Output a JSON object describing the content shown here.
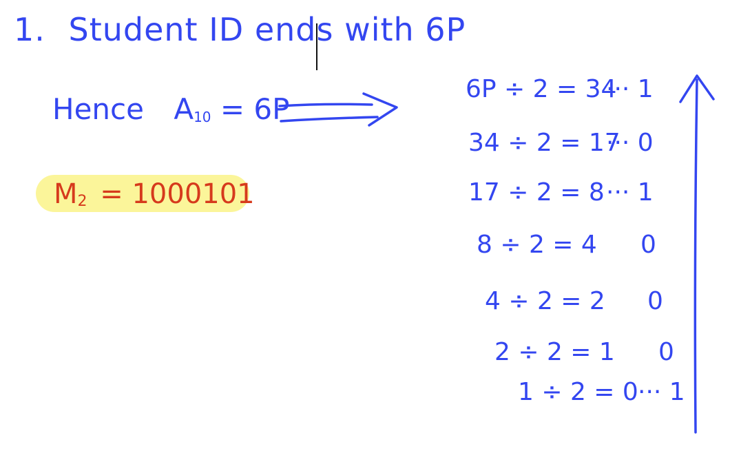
{
  "line1": {
    "number": "1.",
    "text": "Student ID ends with 6P"
  },
  "line2": {
    "label": "Hence",
    "var": "A",
    "sub": "10",
    "eq": "= 6P"
  },
  "result": {
    "var": "M",
    "sub": "2",
    "eq": "= 1000101"
  },
  "division_steps": [
    {
      "expr": "6P ÷ 2 = 34",
      "rem": "··· 1"
    },
    {
      "expr": "34 ÷ 2 = 17",
      "rem": "··· 0"
    },
    {
      "expr": "17 ÷ 2 = 8",
      "rem": "··· 1"
    },
    {
      "expr": "8 ÷ 2 = 4",
      "rem": "0"
    },
    {
      "expr": "4 ÷ 2 = 2",
      "rem": "0"
    },
    {
      "expr": "2 ÷ 2 = 1",
      "rem": "0"
    },
    {
      "expr": "1 ÷ 2 = 0",
      "rem": "··· 1"
    }
  ],
  "colors": {
    "ink_blue": "#3346f0",
    "ink_red": "#d63a1c",
    "highlight": "#fbf59a"
  }
}
